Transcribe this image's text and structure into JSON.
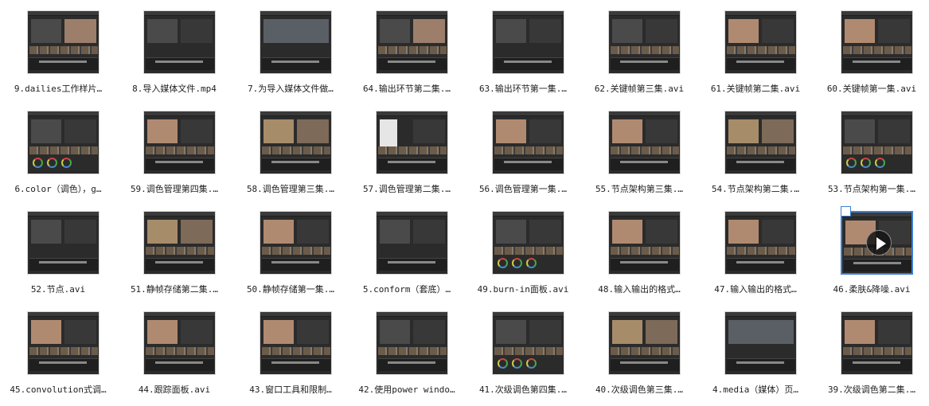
{
  "files": [
    {
      "name": "9.dailies工作样片…",
      "style": "photo-right"
    },
    {
      "name": "8.导入媒体文件.mp4",
      "style": "dark-split"
    },
    {
      "name": "7.为导入媒体文件做…",
      "style": "dialog"
    },
    {
      "name": "64.输出环节第二集.…",
      "style": "photo-right"
    },
    {
      "name": "63.输出环节第一集.…",
      "style": "dark-split"
    },
    {
      "name": "62.关键帧第三集.avi",
      "style": "timeline"
    },
    {
      "name": "61.关键帧第二集.avi",
      "style": "photo-left"
    },
    {
      "name": "60.关键帧第一集.avi",
      "style": "photo-left"
    },
    {
      "name": "6.color（调色），g…",
      "style": "wheels"
    },
    {
      "name": "59.调色管理第四集.…",
      "style": "photo-left"
    },
    {
      "name": "58.调色管理第三集.…",
      "style": "photo-grid"
    },
    {
      "name": "57.调色管理第二集.…",
      "style": "menu"
    },
    {
      "name": "56.调色管理第一集.…",
      "style": "photo-left"
    },
    {
      "name": "55.节点架构第三集.…",
      "style": "photo-left"
    },
    {
      "name": "54.节点架构第二集.…",
      "style": "photo-grid"
    },
    {
      "name": "53.节点架构第一集.…",
      "style": "wheels"
    },
    {
      "name": "52.节点.avi",
      "style": "dark-split"
    },
    {
      "name": "51.静帧存储第二集.…",
      "style": "photo-grid"
    },
    {
      "name": "50.静帧存储第一集.…",
      "style": "photo-left"
    },
    {
      "name": "5.conform（套底）…",
      "style": "dark-split"
    },
    {
      "name": "49.burn-in面板.avi",
      "style": "wheels"
    },
    {
      "name": "48.输入输出的格式…",
      "style": "photo-left"
    },
    {
      "name": "47.输入输出的格式…",
      "style": "photo-left"
    },
    {
      "name": "46.柔肤&降噪.avi",
      "style": "selected"
    },
    {
      "name": "45.convolution式调…",
      "style": "photo-left"
    },
    {
      "name": "44.跟踪面板.avi",
      "style": "photo-left"
    },
    {
      "name": "43.窗口工具和限制…",
      "style": "photo-left"
    },
    {
      "name": "42.使用power windo…",
      "style": "timeline"
    },
    {
      "name": "41.次级调色第四集.…",
      "style": "wheels"
    },
    {
      "name": "40.次级调色第三集.…",
      "style": "photo-grid"
    },
    {
      "name": "4.media（媒体）页…",
      "style": "dialog"
    },
    {
      "name": "39.次级调色第二集.…",
      "style": "photo-left"
    }
  ],
  "colors": {
    "selection": "#3c7fd8"
  },
  "icons": {
    "play": "play-icon",
    "checkbox": "checkbox-icon"
  }
}
